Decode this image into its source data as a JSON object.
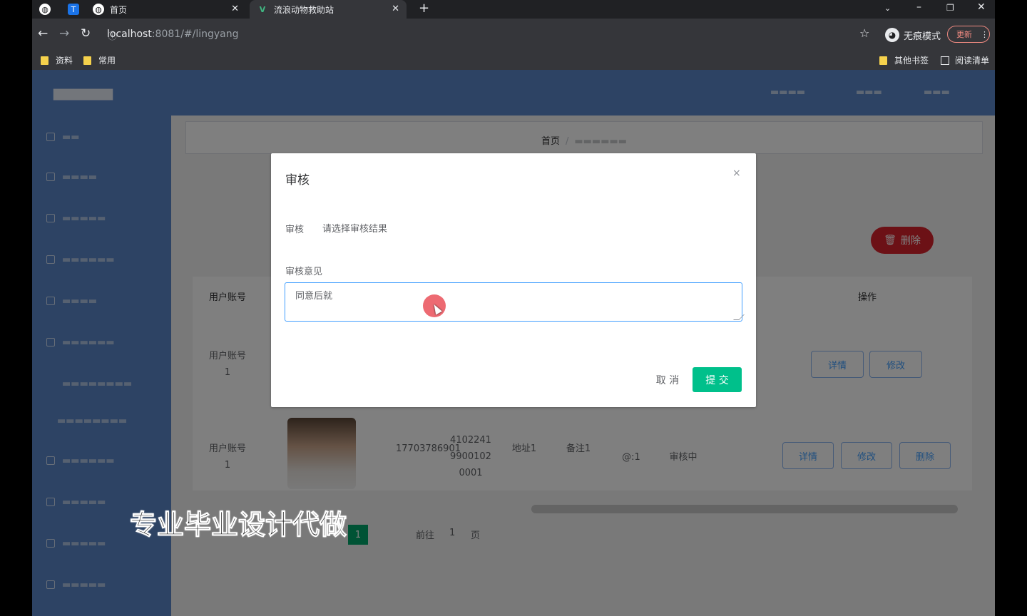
{
  "browser": {
    "tabs": [
      {
        "label": ""
      },
      {
        "label": ""
      },
      {
        "label": "首页"
      },
      {
        "label": "流浪动物救助站"
      }
    ],
    "url": {
      "host": "localhost",
      "rest": ":8081/#/lingyang"
    },
    "profile": "无痕模式",
    "update": "更新",
    "bookmarks": {
      "left": [
        "资料",
        "常用"
      ],
      "right": [
        "其他书签",
        "阅读清单"
      ]
    }
  },
  "app": {
    "breadcrumb": {
      "home": "首页"
    },
    "delete_button": "删除",
    "table": {
      "headers": [
        "用户账号",
        "操作"
      ],
      "rows": [
        {
          "account": "用户账号1",
          "buttons": [
            "详情",
            "修改"
          ]
        },
        {
          "account": "用户账号1",
          "phone": "17703786901",
          "id_card": "410224199001020001",
          "address": "地址1",
          "info": "备注1",
          "status": "@:1",
          "status2": "审核中",
          "buttons": [
            "详情",
            "修改",
            "删除"
          ]
        }
      ]
    },
    "pager": {
      "prefix": "前往",
      "page": "1",
      "suffix": "页",
      "current": "1"
    }
  },
  "dialog": {
    "title": "审核",
    "close": "×",
    "audit_label": "审核",
    "audit_placeholder": "请选择审核结果",
    "opinion_label": "审核意见",
    "opinion_value": "同意后就",
    "cancel": "取 消",
    "submit": "提 交"
  },
  "watermark": "专业毕业设计代做",
  "colors": {
    "primary": "#409eff",
    "submit": "#00c08b",
    "danger": "#d9232d",
    "sidebar": "#5a86c8"
  }
}
